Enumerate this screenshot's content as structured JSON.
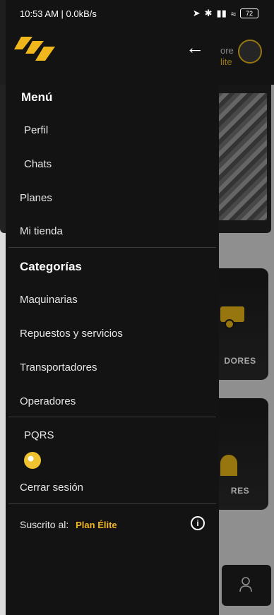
{
  "status_bar": {
    "time": "10:53 AM | 0.0kB/s",
    "battery": "72"
  },
  "background": {
    "user_line1": "ore",
    "user_line2": "lite",
    "card1_label": "DORES",
    "card2_label": "RES"
  },
  "drawer": {
    "menu_title": "Menú",
    "menu_items": [
      "Perfil",
      "Chats",
      "Planes",
      "Mi tienda"
    ],
    "categories_title": "Categorías",
    "category_items": [
      "Maquinarias",
      "Repuestos y servicios",
      "Transportadores",
      "Operadores"
    ],
    "pqrs_label": "PQRS",
    "logout_label": "Cerrar sesión",
    "subscribed_label": "Suscrito al:",
    "plan_name": "Plan Élite"
  },
  "colors": {
    "accent": "#f0b71d",
    "drawer_bg": "#131313"
  }
}
